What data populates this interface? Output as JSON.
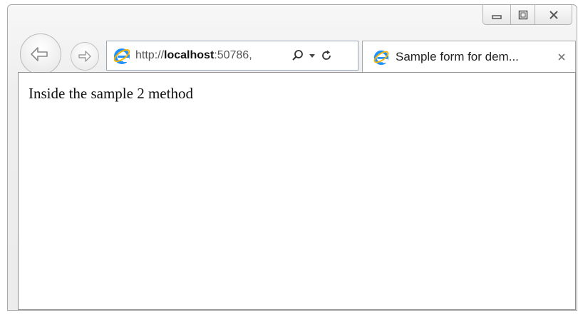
{
  "window": {
    "controls": {
      "minimize_icon": "minimize-icon",
      "maximize_icon": "restore-icon",
      "close_icon": "close-icon"
    }
  },
  "nav": {
    "back_icon": "back-arrow-icon",
    "forward_icon": "forward-arrow-icon"
  },
  "address_bar": {
    "scheme": "http://",
    "host": "localhost",
    "rest": ":50786,"
  },
  "tab": {
    "title": "Sample form for dem...",
    "close_label": "×"
  },
  "content": {
    "text": "Inside the sample 2 method"
  },
  "colors": {
    "ie_blue": "#1e90ff",
    "ie_ring": "#f4b400"
  }
}
